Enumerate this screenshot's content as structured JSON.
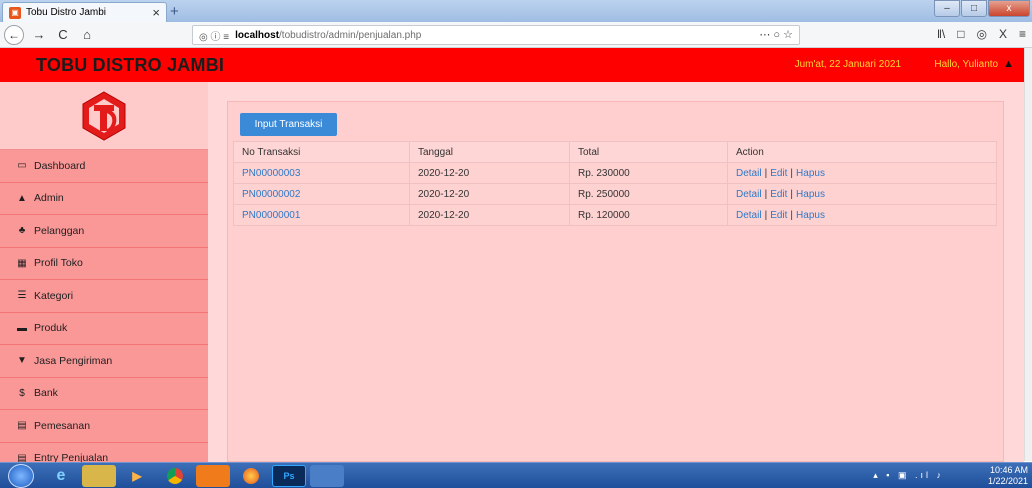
{
  "browser": {
    "tab_title": "Tobu Distro Jambi",
    "tab_close": "×",
    "new_tab": "+",
    "window_title": "",
    "url_prefix_icons": "◎ ⓘ ≡",
    "url_host": "localhost",
    "url_path": "/tobudistro/admin/penjualan.php",
    "url_actions": "⋯ ○ ☆",
    "nav_icons": [
      "library-icon",
      "reader-icon",
      "extension-icon",
      "close-icon",
      "menu-icon"
    ],
    "nav_glyphs": [
      "‖\\",
      "□",
      "◎",
      "X",
      "≡"
    ],
    "window_controls": [
      "–",
      "□",
      "x"
    ]
  },
  "header": {
    "brand": "TOBU DISTRO JAMBI",
    "date": "Jum'at, 22 Januari 2021",
    "user": "Hallo, Yulianto"
  },
  "sidebar": {
    "items": [
      {
        "label": "Dashboard",
        "icon": "monitor-icon",
        "glyph": "▭"
      },
      {
        "label": "Admin",
        "icon": "user-icon",
        "glyph": "▲"
      },
      {
        "label": "Pelanggan",
        "icon": "users-icon",
        "glyph": "♣"
      },
      {
        "label": "Profil Toko",
        "icon": "table-icon",
        "glyph": "▦"
      },
      {
        "label": "Kategori",
        "icon": "list-icon",
        "glyph": "☰"
      },
      {
        "label": "Produk",
        "icon": "truck-icon",
        "glyph": "▬"
      },
      {
        "label": "Jasa Pengiriman",
        "icon": "map-marker-icon",
        "glyph": "▼"
      },
      {
        "label": "Bank",
        "icon": "dollar-icon",
        "glyph": "$"
      },
      {
        "label": "Pemesanan",
        "icon": "card-icon",
        "glyph": "▤"
      },
      {
        "label": "Entry Penjualan",
        "icon": "card-icon",
        "glyph": "▤"
      }
    ]
  },
  "main": {
    "input_button": "Input Transaksi",
    "columns": [
      "No Transaksi",
      "Tanggal",
      "Total",
      "Action"
    ],
    "rows": [
      {
        "no": "PN00000003",
        "tanggal": "2020-12-20",
        "total": "Rp. 230000"
      },
      {
        "no": "PN00000002",
        "tanggal": "2020-12-20",
        "total": "Rp. 250000"
      },
      {
        "no": "PN00000001",
        "tanggal": "2020-12-20",
        "total": "Rp. 120000"
      }
    ],
    "actions": {
      "detail": "Detail",
      "edit": "Edit",
      "hapus": "Hapus",
      "separator": "|"
    }
  },
  "taskbar": {
    "apps": [
      "ie",
      "explorer",
      "media",
      "chrome",
      "xampp",
      "firefox",
      "photoshop",
      "notepad"
    ],
    "ps_label": "Ps",
    "tray": "▴ ▪ ▣ .ıl ♪",
    "time": "10:46 AM",
    "date": "1/22/2021"
  },
  "colors": {
    "header_red": "#fe0000",
    "header_yellow": "#ffd633",
    "sidebar_pink": "#fa9898",
    "content_pink": "#ffd9d9",
    "button_blue": "#3a8ad8",
    "link_blue": "#2e79c6"
  }
}
